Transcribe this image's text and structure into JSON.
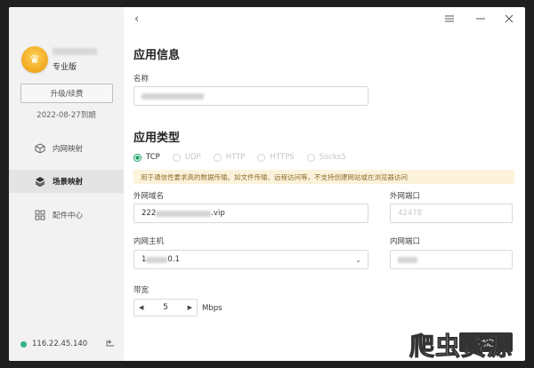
{
  "sidebar": {
    "edition": "专业版",
    "upgrade_label": "升级/续费",
    "expire_text": "2022-08-27到期",
    "nav": [
      {
        "label": "内网映射",
        "icon": "cube-icon"
      },
      {
        "label": "场景映射",
        "icon": "scene-icon"
      },
      {
        "label": "配件中心",
        "icon": "grid-icon"
      }
    ],
    "active_nav": "场景映射",
    "ip": "116.22.45.140",
    "status_color": "#36b37e"
  },
  "titlebar": {
    "back_icon": "chevron-left-icon",
    "menu_icon": "hamburger-icon",
    "minimize_icon": "minimize-icon",
    "close_icon": "close-icon"
  },
  "app_info": {
    "title": "应用信息",
    "name_label": "名称"
  },
  "app_type": {
    "title": "应用类型",
    "options": [
      "TCP",
      "UDP",
      "HTTP",
      "HTTPS",
      "Socks5"
    ],
    "selected": "TCP",
    "hint": "用于通信性要求高的数据传输。如文件传输、远程访问等，不支持创建网站或在浏览器访问",
    "ext_domain_label": "外网域名",
    "ext_domain_prefix": "222",
    "ext_domain_suffix": ".vip",
    "ext_port_label": "外网端口",
    "ext_port_placeholder": "42478",
    "int_host_label": "内网主机",
    "int_host_prefix": "1",
    "int_host_suffix": "0.1",
    "int_port_label": "内网端口",
    "bandwidth_label": "带宽",
    "bandwidth_value": "5",
    "bandwidth_unit": "Mbps"
  },
  "ok_label": "确定",
  "watermark": "爬虫资源",
  "accent_color": "#1aa262"
}
